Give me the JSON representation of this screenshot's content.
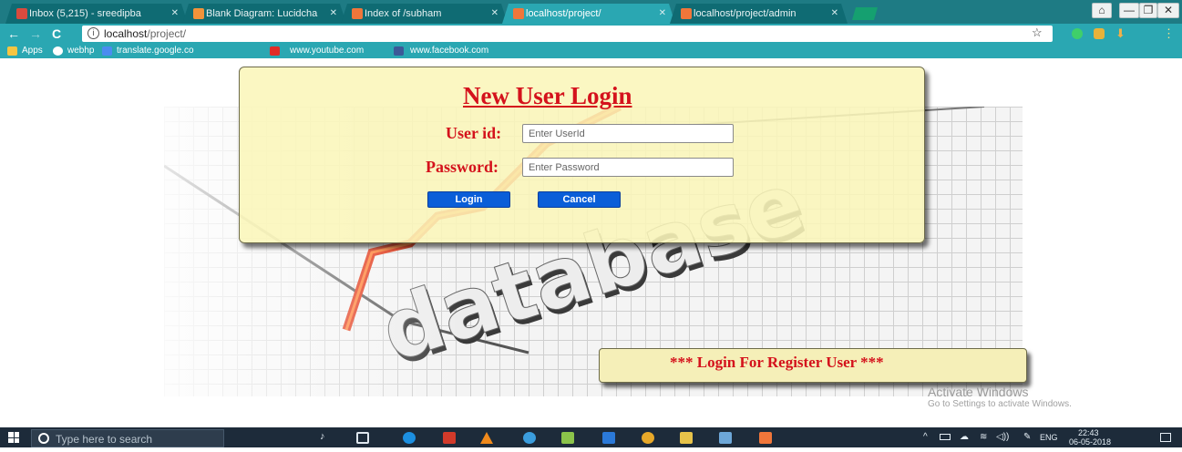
{
  "browser": {
    "tabs": [
      {
        "label": "Inbox (5,215) - sreedipba",
        "icon": "gmail-icon",
        "color": "#d84b3e"
      },
      {
        "label": "Blank Diagram: Lucidcha",
        "icon": "lucidchart-icon",
        "color": "#f2933a"
      },
      {
        "label": "Index of /subham",
        "icon": "xampp-icon",
        "color": "#f0763a"
      },
      {
        "label": "localhost/project/",
        "icon": "xampp-icon",
        "color": "#f0763a"
      },
      {
        "label": "localhost/project/admin",
        "icon": "xampp-icon",
        "color": "#f0763a"
      }
    ],
    "window_controls": {
      "minimize": "—",
      "restore": "❐",
      "close": "✕"
    },
    "address": {
      "host": "localhost",
      "path": "/project/"
    },
    "bookmarks": [
      "Apps",
      "webhp",
      "translate.google.co",
      "www.youtube.com",
      "www.facebook.com"
    ]
  },
  "login": {
    "title": "New User Login",
    "userid_label": "User id:",
    "userid_placeholder": "Enter UserId",
    "password_label": "Password:",
    "password_placeholder": "Enter Password",
    "login_button": "Login",
    "cancel_button": "Cancel"
  },
  "register_banner": "*** Login For Register User ***",
  "watermark": {
    "line1": "Activate Windows",
    "line2": "Go to Settings to activate Windows."
  },
  "hero_image": {
    "word": "database"
  },
  "taskbar": {
    "search_placeholder": "Type here to search",
    "language": "ENG",
    "time": "22:43",
    "date": "06-05-2018"
  },
  "colors": {
    "accent_red": "#d4121c",
    "panel_yellow": "#faf6b9",
    "button_blue": "#0a5ed8",
    "browser_teal": "#2aa7b2"
  }
}
